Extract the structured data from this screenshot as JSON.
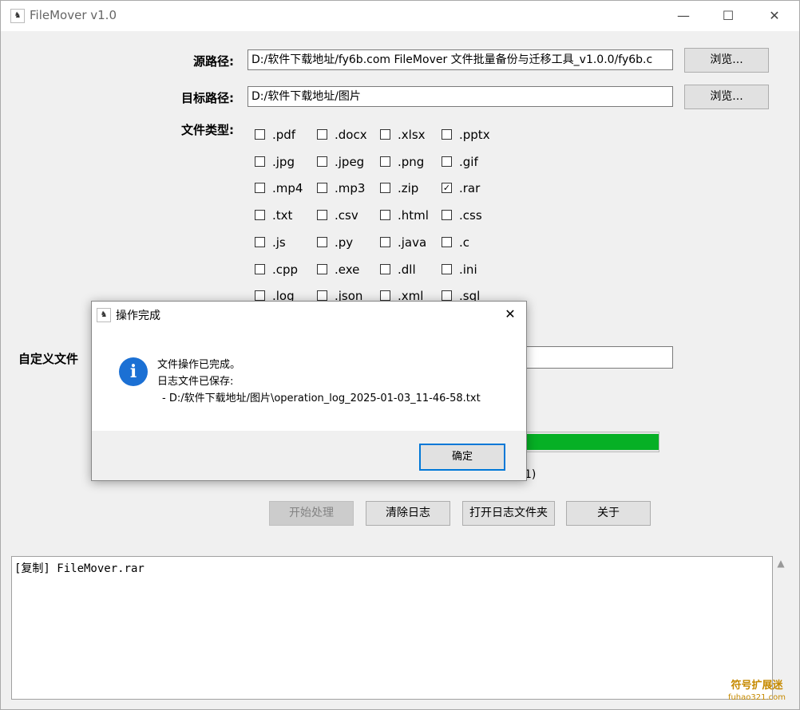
{
  "window": {
    "title": "FileMover v1.0",
    "icon": "app-icon",
    "minimize": "—",
    "maximize": "☐",
    "close": "✕"
  },
  "source": {
    "label": "源路径:",
    "value": "D:/软件下载地址/fy6b.com FileMover 文件批量备份与迁移工具_v1.0.0/fy6b.c",
    "browse": "浏览..."
  },
  "target": {
    "label": "目标路径:",
    "value": "D:/软件下载地址/图片",
    "browse": "浏览..."
  },
  "file_types": {
    "label": "文件类型:",
    "rows": [
      [
        ".pdf",
        ".docx",
        ".xlsx",
        ".pptx"
      ],
      [
        ".jpg",
        ".jpeg",
        ".png",
        ".gif"
      ],
      [
        ".mp4",
        ".mp3",
        ".zip",
        ".rar"
      ],
      [
        ".txt",
        ".csv",
        ".html",
        ".css"
      ],
      [
        ".js",
        ".py",
        ".java",
        ".c"
      ],
      [
        ".cpp",
        ".exe",
        ".dll",
        ".ini"
      ],
      [
        ".log",
        ".json",
        ".xml",
        ".sql"
      ]
    ],
    "checked": [
      ".rar"
    ]
  },
  "custom_type": {
    "label": "自定义文件",
    "value": ""
  },
  "progress": {
    "value": 1.0,
    "status_text": "1)"
  },
  "actions": {
    "start": "开始处理",
    "clear_log": "清除日志",
    "open_log_folder": "打开日志文件夹",
    "about": "关于"
  },
  "log": {
    "lines": [
      "[复制] FileMover.rar"
    ]
  },
  "dialog": {
    "title": "操作完成",
    "line1": "文件操作已完成。",
    "line2": "日志文件已保存:",
    "line3": "- D:/软件下载地址/图片\\operation_log_2025-01-03_11-46-58.txt",
    "ok": "确定",
    "close": "✕",
    "icon_glyph": "i"
  },
  "watermark": {
    "line1": "符号扩展迷",
    "line2": "fuhao321.com"
  }
}
